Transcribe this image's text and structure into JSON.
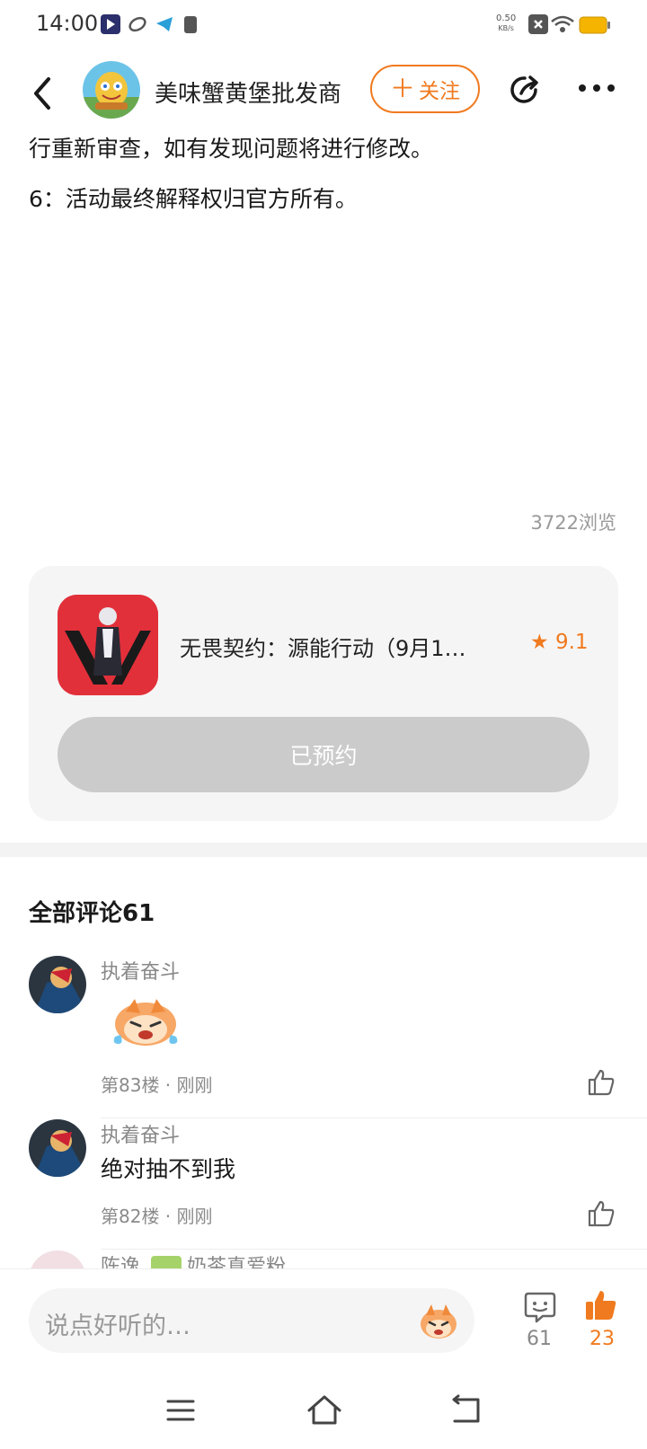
{
  "status_bar": {
    "time": "14:00",
    "net_speed_value": "0.50",
    "net_speed_unit": "KB/s",
    "battery_color": "#f5b400"
  },
  "header": {
    "author": "美味蟹黄堡批发商",
    "follow_label": "关注",
    "follow_icon": "plus-icon",
    "accent_color": "#f07a1f"
  },
  "article": {
    "lines": [
      "行重新审查，如有发现问题将进行修改。",
      "6：活动最终解释权归官方所有。"
    ],
    "views": "3722浏览"
  },
  "game_card": {
    "title": "无畏契约：源能行动（9月1…",
    "rating": "9.1",
    "button_label": "已预约"
  },
  "comments": {
    "title": "全部评论61",
    "items": [
      {
        "name": "执着奋斗",
        "text": "",
        "has_sticker": true,
        "meta": "第83楼 · 刚刚"
      },
      {
        "name": "执着奋斗",
        "text": "绝对抽不到我",
        "has_sticker": false,
        "meta": "第82楼 · 刚刚"
      },
      {
        "name": "陈逸",
        "badge": "奶茶真爱粉"
      }
    ]
  },
  "bottom_bar": {
    "input_placeholder": "说点好听的…",
    "comment_count": "61",
    "like_count": "23"
  }
}
